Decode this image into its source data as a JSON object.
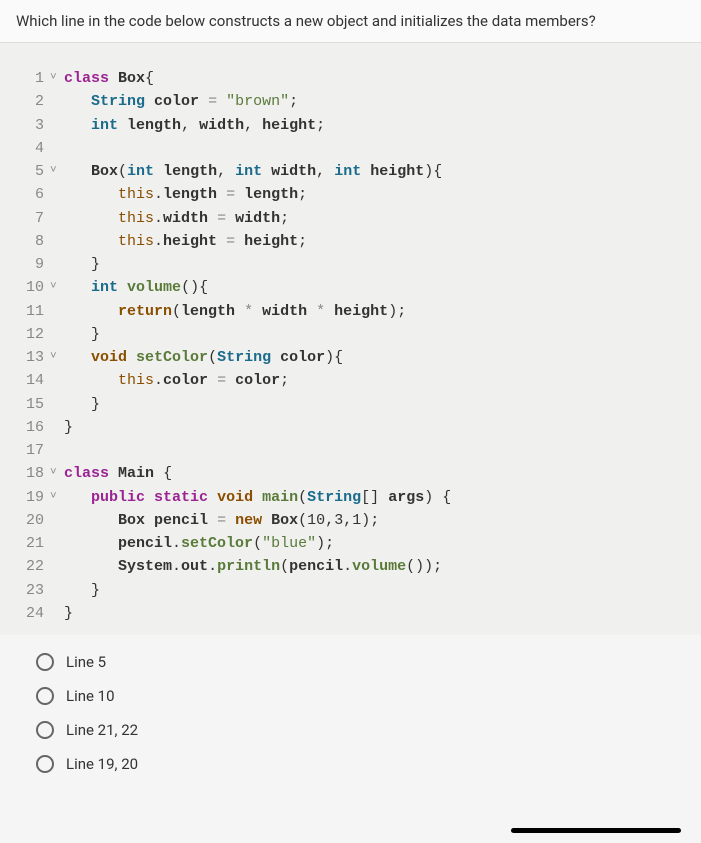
{
  "question": "Which line in the code below constructs a new object and initializes the data members?",
  "code": {
    "lines": [
      {
        "n": "1",
        "fold": "˅",
        "parts": [
          "<span class='kw-class'>class</span> <span class='classname'>Box</span><span class='punct'>{</span>"
        ]
      },
      {
        "n": "2",
        "fold": "",
        "parts": [
          "   <span class='kw-type'>String</span> <span class='ident'>color</span> <span class='op'>=</span> <span class='str'>\"brown\"</span><span class='punct'>;</span>"
        ]
      },
      {
        "n": "3",
        "fold": "",
        "parts": [
          "   <span class='kw-type'>int</span> <span class='ident'>length</span><span class='punct'>,</span> <span class='ident'>width</span><span class='punct'>,</span> <span class='ident'>height</span><span class='punct'>;</span>"
        ]
      },
      {
        "n": "4",
        "fold": "",
        "parts": [
          ""
        ]
      },
      {
        "n": "5",
        "fold": "˅",
        "parts": [
          "   <span class='classname'>Box</span><span class='punct'>(</span><span class='kw-type'>int</span> <span class='ident'>length</span><span class='punct'>,</span> <span class='kw-type'>int</span> <span class='ident'>width</span><span class='punct'>,</span> <span class='kw-type'>int</span> <span class='ident'>height</span><span class='punct'>){</span>"
        ]
      },
      {
        "n": "6",
        "fold": "",
        "parts": [
          "      <span class='kw-this'>this</span><span class='punct'>.</span><span class='ident'>length</span> <span class='op'>=</span> <span class='ident'>length</span><span class='punct'>;</span>"
        ]
      },
      {
        "n": "7",
        "fold": "",
        "parts": [
          "      <span class='kw-this'>this</span><span class='punct'>.</span><span class='ident'>width</span> <span class='op'>=</span> <span class='ident'>width</span><span class='punct'>;</span>"
        ]
      },
      {
        "n": "8",
        "fold": "",
        "parts": [
          "      <span class='kw-this'>this</span><span class='punct'>.</span><span class='ident'>height</span> <span class='op'>=</span> <span class='ident'>height</span><span class='punct'>;</span>"
        ]
      },
      {
        "n": "9",
        "fold": "",
        "parts": [
          "   <span class='punct'>}</span>"
        ]
      },
      {
        "n": "10",
        "fold": "˅",
        "parts": [
          "   <span class='kw-type'>int</span> <span class='method'>volume</span><span class='punct'>(){</span>"
        ]
      },
      {
        "n": "11",
        "fold": "",
        "parts": [
          "      <span class='kw-return'>return</span><span class='punct'>(</span><span class='ident'>length</span> <span class='op'>*</span> <span class='ident'>width</span> <span class='op'>*</span> <span class='ident'>height</span><span class='punct'>);</span>"
        ]
      },
      {
        "n": "12",
        "fold": "",
        "parts": [
          "   <span class='punct'>}</span>"
        ]
      },
      {
        "n": "13",
        "fold": "˅",
        "parts": [
          "   <span class='kw-void'>void</span> <span class='method'>setColor</span><span class='punct'>(</span><span class='kw-type'>String</span> <span class='ident'>color</span><span class='punct'>){</span>"
        ]
      },
      {
        "n": "14",
        "fold": "",
        "parts": [
          "      <span class='kw-this'>this</span><span class='punct'>.</span><span class='ident'>color</span> <span class='op'>=</span> <span class='ident'>color</span><span class='punct'>;</span>"
        ]
      },
      {
        "n": "15",
        "fold": "",
        "parts": [
          "   <span class='punct'>}</span>"
        ]
      },
      {
        "n": "16",
        "fold": "",
        "parts": [
          "<span class='punct'>}</span>"
        ]
      },
      {
        "n": "17",
        "fold": "",
        "parts": [
          ""
        ]
      },
      {
        "n": "18",
        "fold": "˅",
        "parts": [
          "<span class='kw-class'>class</span> <span class='classname'>Main</span> <span class='punct'>{</span>"
        ]
      },
      {
        "n": "19",
        "fold": "˅",
        "parts": [
          "   <span class='kw-pub'>public</span> <span class='kw-static'>static</span> <span class='kw-void'>void</span> <span class='method'>main</span><span class='punct'>(</span><span class='kw-type'>String</span><span class='punct'>[]</span> <span class='ident'>args</span><span class='punct'>) {</span>"
        ]
      },
      {
        "n": "20",
        "fold": "",
        "parts": [
          "      <span class='classname'>Box</span> <span class='ident'>pencil</span> <span class='op'>=</span> <span class='kw-new'>new</span> <span class='classname'>Box</span><span class='punct'>(</span>10<span class='punct'>,</span>3<span class='punct'>,</span>1<span class='punct'>);</span>"
        ]
      },
      {
        "n": "21",
        "fold": "",
        "parts": [
          "      <span class='ident'>pencil</span><span class='punct'>.</span><span class='method'>setColor</span><span class='punct'>(</span><span class='str'>\"blue\"</span><span class='punct'>);</span>"
        ]
      },
      {
        "n": "22",
        "fold": "",
        "parts": [
          "      <span class='classname'>System</span><span class='punct'>.</span><span class='ident'>out</span><span class='punct'>.</span><span class='method'>println</span><span class='punct'>(</span><span class='ident'>pencil</span><span class='punct'>.</span><span class='method'>volume</span><span class='punct'>());</span>"
        ]
      },
      {
        "n": "23",
        "fold": "",
        "parts": [
          "   <span class='punct'>}</span>"
        ]
      },
      {
        "n": "24",
        "fold": "",
        "parts": [
          "<span class='punct'>}</span>"
        ]
      }
    ]
  },
  "options": [
    {
      "label": "Line 5"
    },
    {
      "label": "Line 10"
    },
    {
      "label": "Line 21, 22"
    },
    {
      "label": "Line 19, 20"
    }
  ]
}
